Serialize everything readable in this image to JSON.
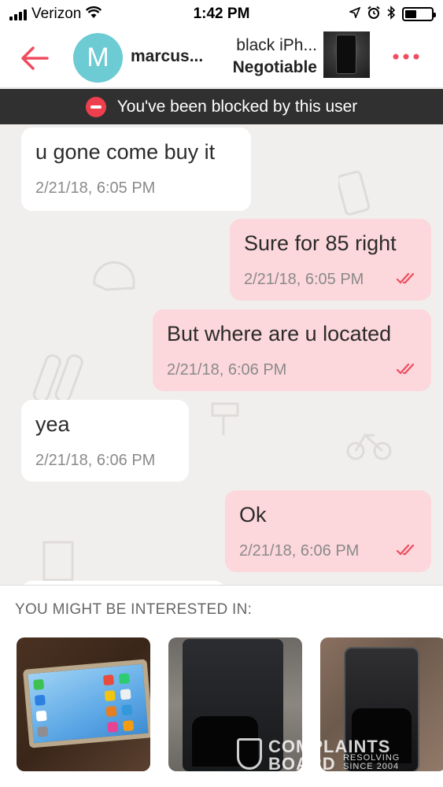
{
  "status_bar": {
    "carrier": "Verizon",
    "time": "1:42 PM",
    "icons": [
      "signal-icon",
      "wifi-icon",
      "location-icon",
      "alarm-icon",
      "bluetooth-icon",
      "battery-icon"
    ],
    "battery_level": 0.45
  },
  "header": {
    "back_icon": "back-arrow-icon",
    "avatar_initial": "M",
    "username": "marcus...",
    "item_title": "black iPh...",
    "item_price": "Negotiable",
    "more_icon": "more-dots-icon",
    "accent_color": "#ee4d5f"
  },
  "banner": {
    "icon": "block-icon",
    "text": "You've been blocked by this user"
  },
  "messages": [
    {
      "direction": "in",
      "text": "u gone come buy it",
      "time": "2/21/18, 6:05 PM"
    },
    {
      "direction": "out",
      "text": "Sure for 85 right",
      "time": "2/21/18, 6:05 PM",
      "read": true
    },
    {
      "direction": "out",
      "text": "But where are u located",
      "time": "2/21/18, 6:06 PM",
      "read": true
    },
    {
      "direction": "in",
      "text": "yea",
      "time": "2/21/18, 6:06 PM"
    },
    {
      "direction": "out",
      "text": "Ok",
      "time": "2/21/18, 6:06 PM",
      "read": true
    }
  ],
  "suggestions": {
    "title": "YOU MIGHT BE INTERESTED IN:",
    "items": [
      {
        "image": "phone-photo-1"
      },
      {
        "image": "phone-photo-2"
      },
      {
        "image": "phone-photo-3"
      }
    ]
  },
  "watermark": {
    "line1": "COMPLAINTS",
    "line2": "BOARD",
    "sub1": "RESOLVING",
    "sub2": "SINCE 2004"
  }
}
